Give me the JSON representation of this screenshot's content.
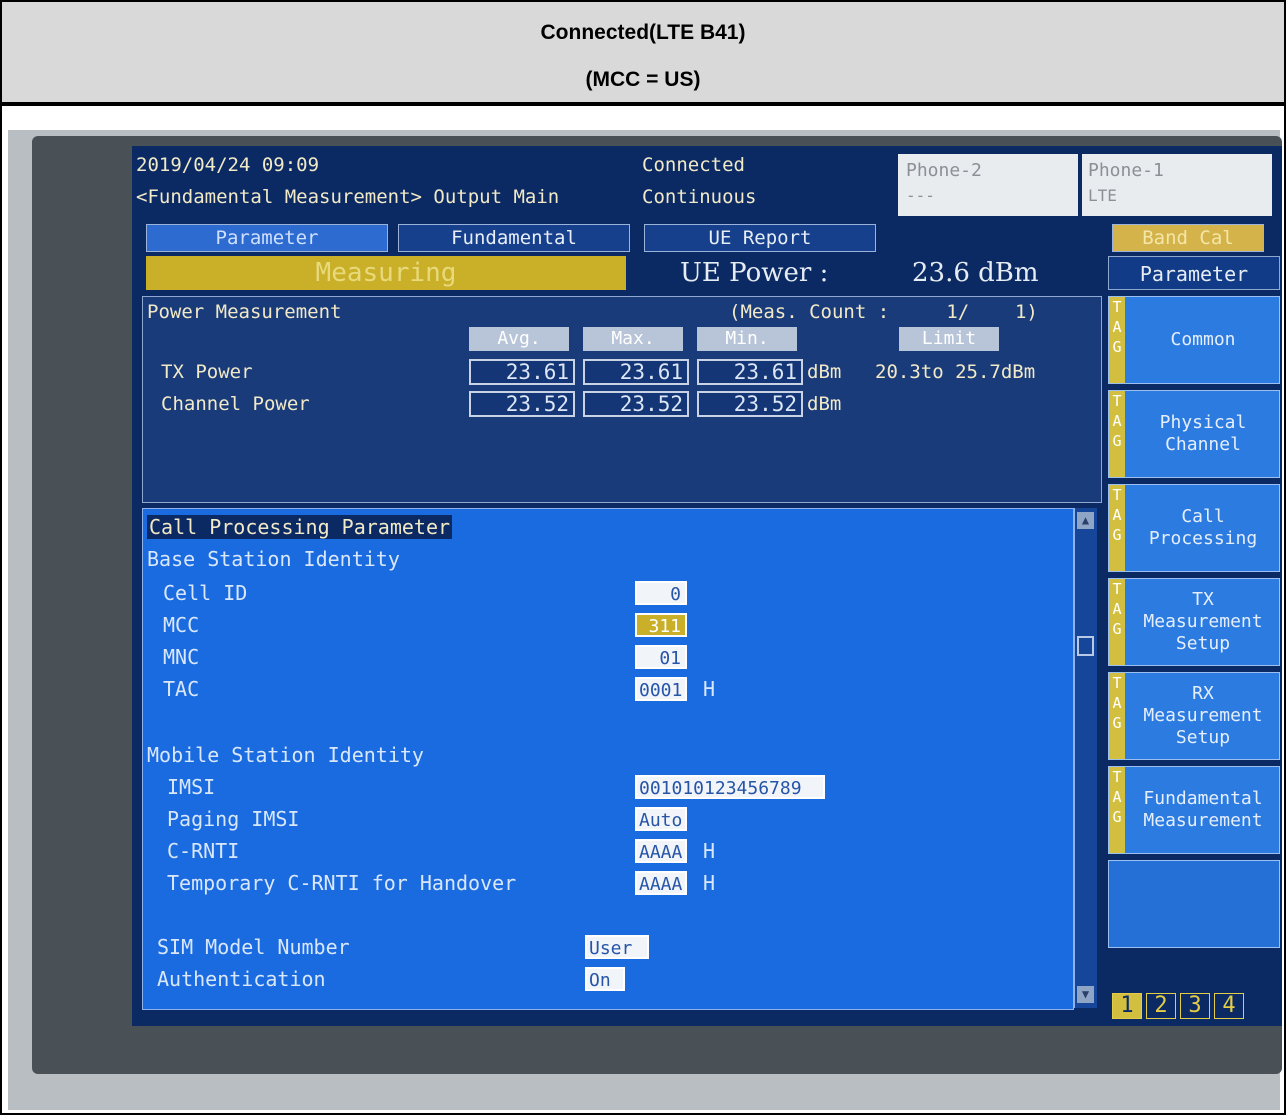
{
  "header": {
    "line1": "Connected(LTE B41)",
    "line2": "(MCC = US)"
  },
  "screen": {
    "datetime": "2019/04/24 09:09",
    "mode": "<Fundamental Measurement> Output Main",
    "status1": "Connected",
    "status2": "Continuous",
    "phone2_label": "Phone-2",
    "phone2_value": "---",
    "phone1_label": "Phone-1",
    "phone1_value": "LTE",
    "tabs": [
      "Parameter",
      "Fundamental",
      "UE Report"
    ],
    "band_cal": "Band Cal",
    "measuring": "Measuring",
    "ue_power_label": "UE Power :",
    "ue_power_value": "23.6 dBm"
  },
  "power_measurement": {
    "title": "Power Measurement",
    "meas_count": "(Meas. Count :     1/    1)",
    "columns": [
      "Avg.",
      "Max.",
      "Min.",
      "Limit"
    ],
    "rows": [
      {
        "label": "TX Power",
        "avg": "23.61",
        "max": "23.61",
        "min": "23.61",
        "unit": "dBm",
        "limit": "20.3to 25.7dBm"
      },
      {
        "label": "Channel Power",
        "avg": "23.52",
        "max": "23.52",
        "min": "23.52",
        "unit": "dBm"
      }
    ]
  },
  "call_processing": {
    "title": "Call Processing Parameter",
    "base_station_heading": "Base Station Identity",
    "cell_id_label": "Cell ID",
    "cell_id_value": "0",
    "mcc_label": "MCC",
    "mcc_value": "311",
    "mnc_label": "MNC",
    "mnc_value": "01",
    "tac_label": "TAC",
    "tac_value": "0001",
    "tac_unit": "H",
    "mobile_station_heading": "Mobile Station Identity",
    "imsi_label": "IMSI",
    "imsi_value": "001010123456789",
    "paging_imsi_label": "Paging IMSI",
    "paging_imsi_value": "Auto",
    "crnti_label": "C-RNTI",
    "crnti_value": "AAAA",
    "crnti_unit": "H",
    "temp_crnti_label": "Temporary C-RNTI for Handover",
    "temp_crnti_value": "AAAA",
    "temp_crnti_unit": "H",
    "sim_model_label": "SIM Model Number",
    "sim_model_value": "User",
    "auth_label": "Authentication",
    "auth_value": "On"
  },
  "side_menu": {
    "header": "Parameter",
    "tag_letters": "T\nA\nG",
    "keys": [
      "Common",
      "Physical\nChannel",
      "Call\nProcessing",
      "TX\nMeasurement\nSetup",
      "RX\nMeasurement\nSetup",
      "Fundamental\nMeasurement",
      ""
    ],
    "pages": [
      "1",
      "2",
      "3",
      "4"
    ]
  }
}
